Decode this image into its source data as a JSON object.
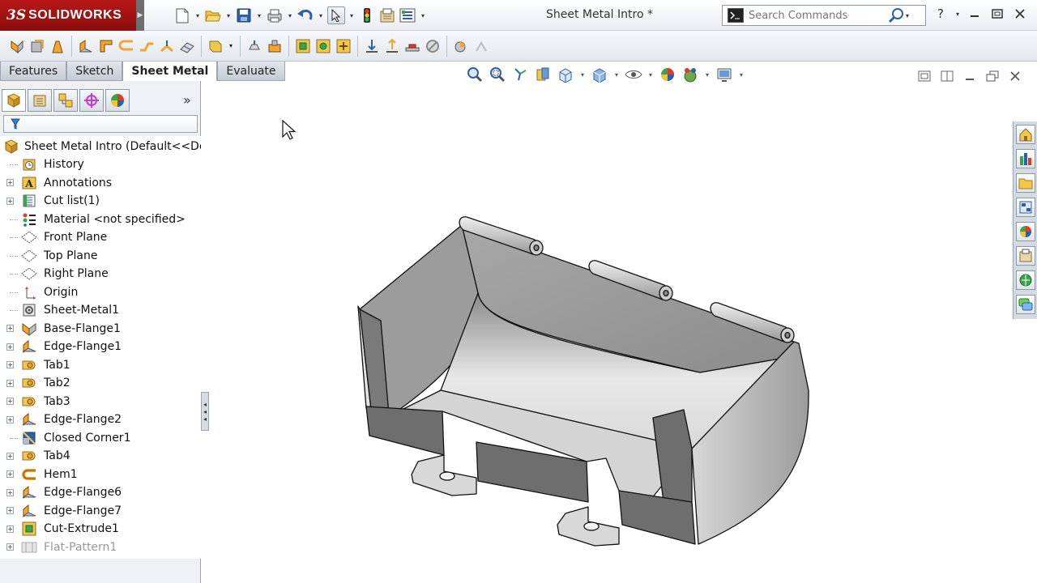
{
  "app": {
    "brand_prefix": "3S",
    "brand_name": "SOLIDWORKS"
  },
  "window": {
    "title": "Sheet Metal Intro *"
  },
  "search": {
    "placeholder": "Search Commands"
  },
  "command_tabs": [
    {
      "label": "Features",
      "active": false
    },
    {
      "label": "Sketch",
      "active": false
    },
    {
      "label": "Sheet Metal",
      "active": true
    },
    {
      "label": "Evaluate",
      "active": false
    }
  ],
  "feature_tree": {
    "root_label": "Sheet Metal Intro  (Default<<Def",
    "items": [
      {
        "label": "History",
        "icon": "history-icon",
        "expandable": false,
        "suppressed": false
      },
      {
        "label": "Annotations",
        "icon": "annotations-icon",
        "expandable": true,
        "suppressed": false
      },
      {
        "label": "Cut list(1)",
        "icon": "cut-list-icon",
        "expandable": true,
        "suppressed": false
      },
      {
        "label": "Material <not specified>",
        "icon": "material-icon",
        "expandable": false,
        "suppressed": false
      },
      {
        "label": "Front Plane",
        "icon": "plane-icon",
        "expandable": false,
        "suppressed": false
      },
      {
        "label": "Top Plane",
        "icon": "plane-icon",
        "expandable": false,
        "suppressed": false
      },
      {
        "label": "Right Plane",
        "icon": "plane-icon",
        "expandable": false,
        "suppressed": false
      },
      {
        "label": "Origin",
        "icon": "origin-icon",
        "expandable": false,
        "suppressed": false
      },
      {
        "label": "Sheet-Metal1",
        "icon": "sheet-metal-icon",
        "expandable": false,
        "suppressed": false
      },
      {
        "label": "Base-Flange1",
        "icon": "base-flange-icon",
        "expandable": true,
        "suppressed": false
      },
      {
        "label": "Edge-Flange1",
        "icon": "edge-flange-icon",
        "expandable": true,
        "suppressed": false
      },
      {
        "label": "Tab1",
        "icon": "tab-icon",
        "expandable": true,
        "suppressed": false
      },
      {
        "label": "Tab2",
        "icon": "tab-icon",
        "expandable": true,
        "suppressed": false
      },
      {
        "label": "Tab3",
        "icon": "tab-icon",
        "expandable": true,
        "suppressed": false
      },
      {
        "label": "Edge-Flange2",
        "icon": "edge-flange-icon",
        "expandable": true,
        "suppressed": false
      },
      {
        "label": "Closed Corner1",
        "icon": "closed-corner-icon",
        "expandable": false,
        "suppressed": false
      },
      {
        "label": "Tab4",
        "icon": "tab-icon",
        "expandable": true,
        "suppressed": false
      },
      {
        "label": "Hem1",
        "icon": "hem-icon",
        "expandable": true,
        "suppressed": false
      },
      {
        "label": "Edge-Flange6",
        "icon": "edge-flange-icon",
        "expandable": true,
        "suppressed": false
      },
      {
        "label": "Edge-Flange7",
        "icon": "edge-flange-icon",
        "expandable": true,
        "suppressed": false
      },
      {
        "label": "Cut-Extrude1",
        "icon": "cut-extrude-icon",
        "expandable": true,
        "suppressed": false
      },
      {
        "label": "Flat-Pattern1",
        "icon": "flat-pattern-icon",
        "expandable": true,
        "suppressed": true
      }
    ]
  },
  "colors": {
    "brand_red": "#a31313",
    "model_gray": "#9c9c9c",
    "selection_blue": "#3c6fa6"
  }
}
